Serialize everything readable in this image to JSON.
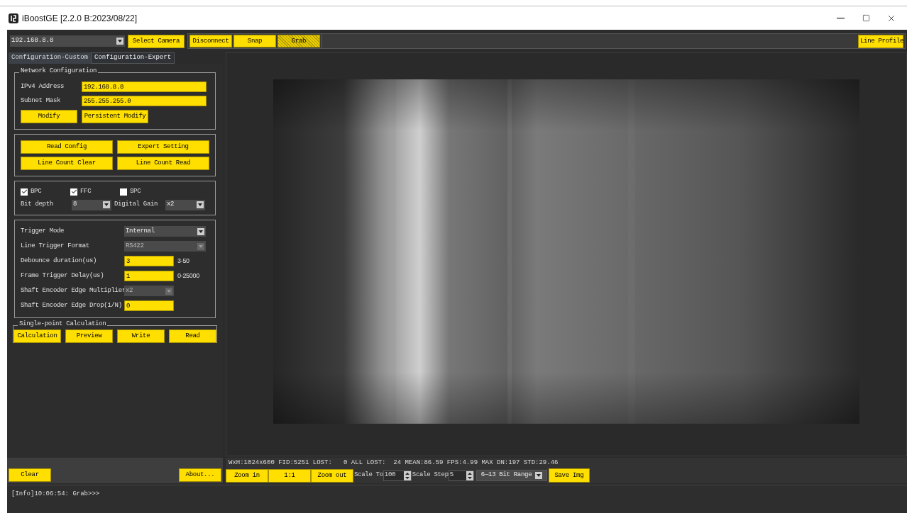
{
  "window": {
    "title": "iBoostGE [2.2.0 B:2023/08/22]"
  },
  "toolbar": {
    "camera": {
      "value": "192.168.8.8"
    },
    "buttons": [
      {
        "label": "Select Camera",
        "pressed": false
      },
      {
        "label": "Disconnect",
        "pressed": false
      },
      {
        "label": "Snap",
        "pressed": false
      },
      {
        "label": "Grab",
        "pressed": true
      }
    ],
    "line_profile": "Line Profile"
  },
  "tabs": [
    {
      "label": "Configuration-Custom",
      "selected": true
    },
    {
      "label": "Configuration-Expert",
      "selected": false
    }
  ],
  "network": {
    "title": "Network Configuration",
    "fields": [
      {
        "label": "IPv4 Address",
        "value": "192.168.8.8"
      },
      {
        "label": "Subnet Mask",
        "value": "255.255.255.0"
      }
    ],
    "buttons": [
      "Modify",
      "Persistent Modify"
    ]
  },
  "config_buttons": [
    "Read Config",
    "Expert Setting",
    "Line Count Clear",
    "Line Count Read"
  ],
  "corrections": [
    {
      "label": "BPC",
      "checked": true
    },
    {
      "label": "FFC",
      "checked": true
    },
    {
      "label": "SPC",
      "checked": false
    }
  ],
  "bit_depth": {
    "label": "Bit depth",
    "value": "8"
  },
  "digital_gain": {
    "label": "Digital Gain",
    "value": "x2"
  },
  "trigger_rows": [
    {
      "kind": "select",
      "label": "Trigger Mode",
      "value": "Internal",
      "disabled": false
    },
    {
      "kind": "select",
      "label": "Line Trigger Format",
      "value": "RS422",
      "disabled": true
    },
    {
      "kind": "input",
      "label": "Debounce duration(us)",
      "value": "3",
      "range": "3-50"
    },
    {
      "kind": "input",
      "label": "Frame Trigger Delay(us)",
      "value": "1",
      "range": "0-25000"
    },
    {
      "kind": "select_short",
      "label": "Shaft Encoder Edge Multiplier",
      "value": "x2",
      "disabled": true
    },
    {
      "kind": "input",
      "label": "Shaft Encoder Edge Drop(1/N)",
      "value": "0"
    }
  ],
  "single_point": {
    "title": "Single-point Calculation",
    "buttons": [
      "Calculation",
      "Preview",
      "Write",
      "Read"
    ]
  },
  "left_footer": {
    "clear": "Clear",
    "about": "About..."
  },
  "status": "WxH:1024x600 FID:5251 LOST:   0 ALL LOST:  24 MEAN:86.59 FPS:4.99 MAX DN:197 STD:29.46",
  "view_controls": {
    "zoom_in": "Zoom in",
    "one_to_one": "1:1",
    "zoom_out": "Zoom out",
    "scale_to_label": "Scale To",
    "scale_to": "100",
    "scale_step_label": "Scale Step",
    "scale_step": "5",
    "bit_range": "6—13 Bit Range",
    "save": "Save Img"
  },
  "log": [
    "[Info]10:06:54: Grab>>>"
  ]
}
